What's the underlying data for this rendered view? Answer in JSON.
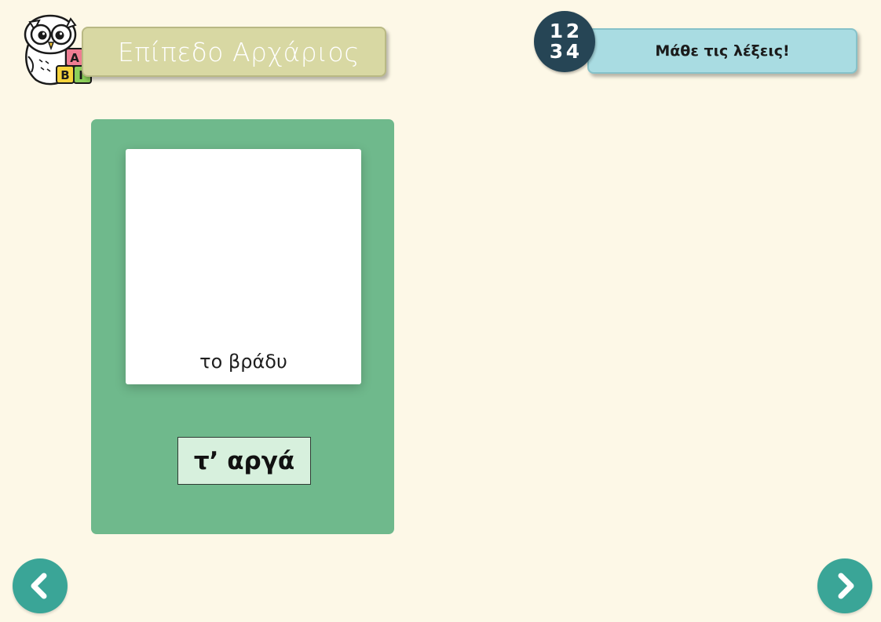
{
  "header": {
    "level_title": "Επίπεδο Αρχάριος",
    "activity_title": "Μάθε τις λέξεις!",
    "badge_digits": [
      "1",
      "2",
      "3",
      "4"
    ],
    "logo_blocks": [
      "Α",
      "Β",
      "Γ"
    ]
  },
  "card": {
    "caption": "το βράδυ",
    "word": "τ’ αργά"
  },
  "navigation": {
    "prev_icon": "chevron-left-icon",
    "next_icon": "chevron-right-icon"
  },
  "colors": {
    "background": "#fdf8e7",
    "level_banner": "#d8d8a3",
    "activity_banner": "#a9dce2",
    "badge": "#264555",
    "card_panel": "#6fb98c",
    "word_tile": "#d7f0dd",
    "nav_button": "#3aa597"
  }
}
